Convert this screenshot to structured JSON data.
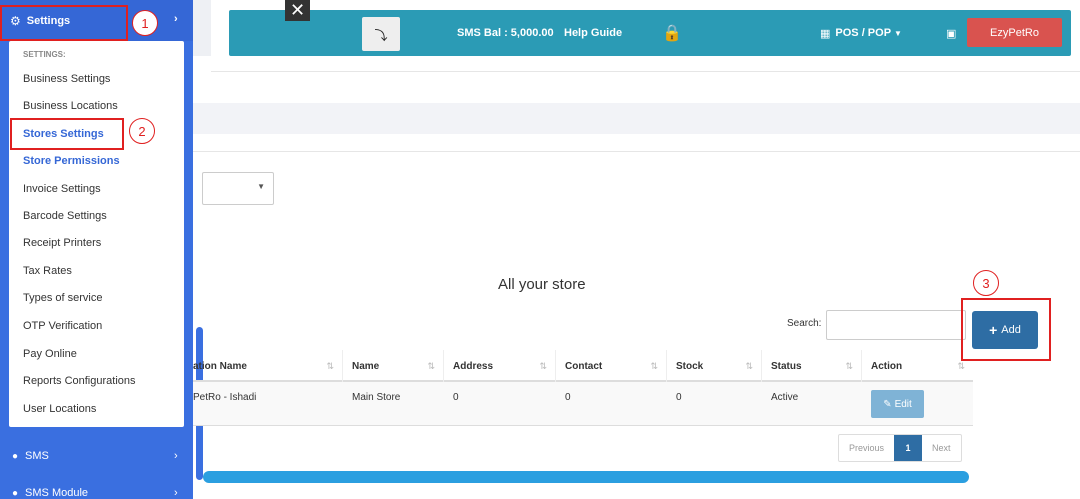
{
  "sidebar": {
    "top_label": "Settings",
    "submenu_header": "SETTINGS:",
    "items": [
      {
        "label": "Business Settings"
      },
      {
        "label": "Business Locations"
      },
      {
        "label": "Stores Settings"
      },
      {
        "label": "Store Permissions"
      },
      {
        "label": "Invoice Settings"
      },
      {
        "label": "Barcode Settings"
      },
      {
        "label": "Receipt Printers"
      },
      {
        "label": "Tax Rates"
      },
      {
        "label": "Types of service"
      },
      {
        "label": "OTP Verification"
      },
      {
        "label": "Pay Online"
      },
      {
        "label": "Reports Configurations"
      },
      {
        "label": "User Locations"
      }
    ],
    "sms_label": "SMS",
    "sms_module_label": "SMS Module"
  },
  "topbar": {
    "sms_balance": "SMS Bal : 5,000.00",
    "help_guide": "Help Guide",
    "pos_label": "POS / POP",
    "user_button": "EzyPetRo"
  },
  "main": {
    "title": "All your store",
    "search_label": "Search:",
    "search_value": "",
    "add_label": "Add"
  },
  "table": {
    "headers": [
      "ation Name",
      "Name",
      "Address",
      "Contact",
      "Stock",
      "Status",
      "Action"
    ],
    "rows": [
      {
        "location": "PetRo - Ishadi",
        "name": "Main Store",
        "address": "0",
        "contact": "0",
        "stock": "0",
        "status": "Active",
        "action": "Edit"
      }
    ]
  },
  "pagination": {
    "previous": "Previous",
    "current": "1",
    "next": "Next"
  },
  "annotations": {
    "step1": "1",
    "step2": "2",
    "step3": "3",
    "color": "#e02020"
  },
  "colors": {
    "sidebar": "#3a6fe0",
    "topbar": "#2b9bb5",
    "primary_button": "#2e6da4",
    "danger_button": "#d9534f"
  }
}
